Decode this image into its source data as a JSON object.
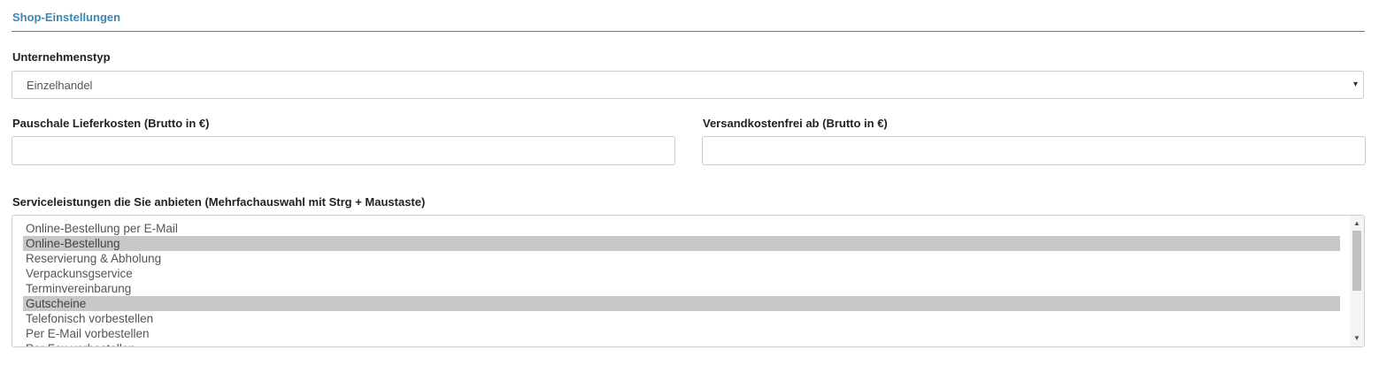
{
  "section": {
    "title": "Shop-Einstellungen"
  },
  "company_type": {
    "label": "Unternehmenstyp",
    "value": "Einzelhandel",
    "arrow": "▾"
  },
  "delivery_cost": {
    "label": "Pauschale Lieferkosten (Brutto in €)",
    "value": ""
  },
  "free_shipping": {
    "label": "Versandkostenfrei ab (Brutto in €)",
    "value": ""
  },
  "services": {
    "label": "Serviceleistungen die Sie anbieten (Mehrfachauswahl mit Strg + Maustaste)",
    "options": [
      {
        "label": "Online-Bestellung per E-Mail",
        "selected": false
      },
      {
        "label": "Online-Bestellung",
        "selected": true
      },
      {
        "label": "Reservierung & Abholung",
        "selected": false
      },
      {
        "label": "Verpackunsgservice",
        "selected": false
      },
      {
        "label": "Terminvereinbarung",
        "selected": false
      },
      {
        "label": "Gutscheine",
        "selected": true
      },
      {
        "label": "Telefonisch vorbestellen",
        "selected": false
      },
      {
        "label": "Per E-Mail vorbestellen",
        "selected": false
      },
      {
        "label": "Per Fax vorbestellen",
        "selected": false
      }
    ],
    "scroll_up": "▲",
    "scroll_down": "▼"
  }
}
